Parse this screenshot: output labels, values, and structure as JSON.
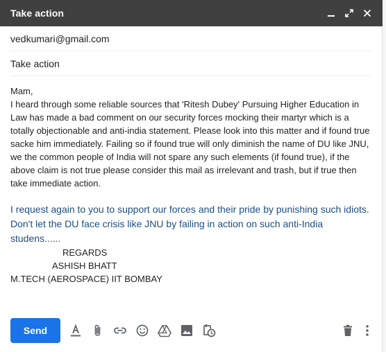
{
  "window": {
    "title": "Take action"
  },
  "to_field": {
    "value": "vedkumari@gmail.com"
  },
  "subject_field": {
    "value": "Take action"
  },
  "body": {
    "greeting": "Mam,",
    "paragraph": "I heard through some reliable sources that 'Ritesh Dubey' Pursuing Higher Education in Law has made a bad comment on our security forces mocking their martyr which is a totally objectionable and anti-india statement. Please look into this matter and if found true sacke him immediately. Failing so if found true will only diminish the name of DU like JNU, we the common people of India will not spare any such elements (if found true), if the above claim is not true please consider this mail as irrelevant and trash, but if true then take immediate action.",
    "request": "I request again to you to support our forces and their pride by punishing such idiots. Don't let the DU face crisis like JNU by failing in action on such anti-India studens......",
    "signature": {
      "line1": "REGARDS",
      "line2": "ASHISH BHATT",
      "line3": "M.TECH (AEROSPACE) IIT BOMBAY"
    }
  },
  "toolbar": {
    "send_label": "Send",
    "icons": [
      "format-text-icon",
      "attach-icon",
      "link-icon",
      "emoji-icon",
      "drive-icon",
      "photo-icon",
      "schedule-icon",
      "trash-icon",
      "more-options-icon"
    ]
  },
  "colors": {
    "titlebar": "#404040",
    "send_button": "#1a73e8",
    "request_text": "#1d4d80"
  }
}
